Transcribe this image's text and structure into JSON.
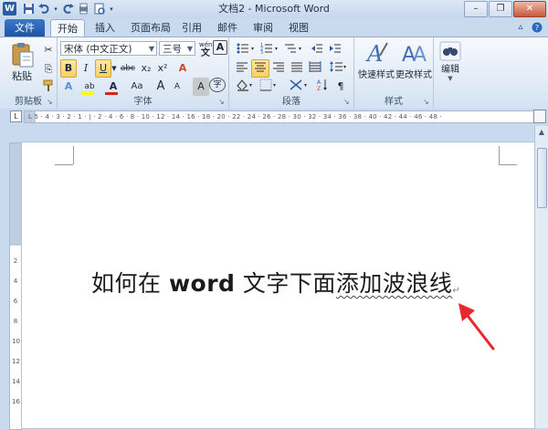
{
  "window": {
    "title": "文档2 - Microsoft Word",
    "app_icon": "W",
    "quick_access": [
      "save-icon",
      "undo-icon",
      "redo-icon",
      "print-preview-icon",
      "customize-icon"
    ],
    "controls": {
      "minimize": "–",
      "restore": "❐",
      "close": "✕"
    }
  },
  "tabs": {
    "file": "文件",
    "items": [
      "开始",
      "插入",
      "页面布局",
      "引用",
      "邮件",
      "审阅",
      "视图"
    ],
    "active": "开始"
  },
  "ribbon": {
    "clipboard": {
      "label": "剪贴板",
      "paste": "粘贴",
      "cut": "✂",
      "copy": "⎘",
      "format_painter": "🖌"
    },
    "font": {
      "label": "字体",
      "font_name": "宋体 (中文正文)",
      "font_size": "三号",
      "phonetic": "wén",
      "border_char": "A",
      "bold": "B",
      "italic": "I",
      "underline": "U",
      "strike": "abc",
      "subscript": "x₂",
      "superscript": "x²",
      "clear_format": "A",
      "text_effect": "A",
      "highlight": "ab",
      "font_color": "A",
      "case": "Aa",
      "grow": "A",
      "shrink": "A",
      "char_shading": "A",
      "enclose": "字"
    },
    "paragraph": {
      "label": "段落"
    },
    "styles": {
      "label": "样式",
      "quick_styles": "快速样式",
      "change_styles": "更改样式"
    },
    "editing": {
      "label": "编辑"
    }
  },
  "ruler": {
    "marks": "L  5 · 4 · 3 · 2 · 1 · | · 2 · 4 · 6 · 8 · 10 · 12 · 14 · 16 · 18 · 20 · 22 · 24 · 26 · 28 · 30 · 32 · 34 · 36 · 38 · 40 · 42 · 44 · 46 · 48 ·"
  },
  "document": {
    "text_part1": "如何在 ",
    "text_word": "word",
    "text_part2": " 文字下面",
    "text_wavy": "添加波浪线",
    "para_mark": "↵"
  },
  "colors": {
    "ribbon_bg": "#dfe9f6",
    "file_tab": "#2a62b4",
    "selected_button": "#f8cf63",
    "annotation_arrow": "#e8262b"
  }
}
